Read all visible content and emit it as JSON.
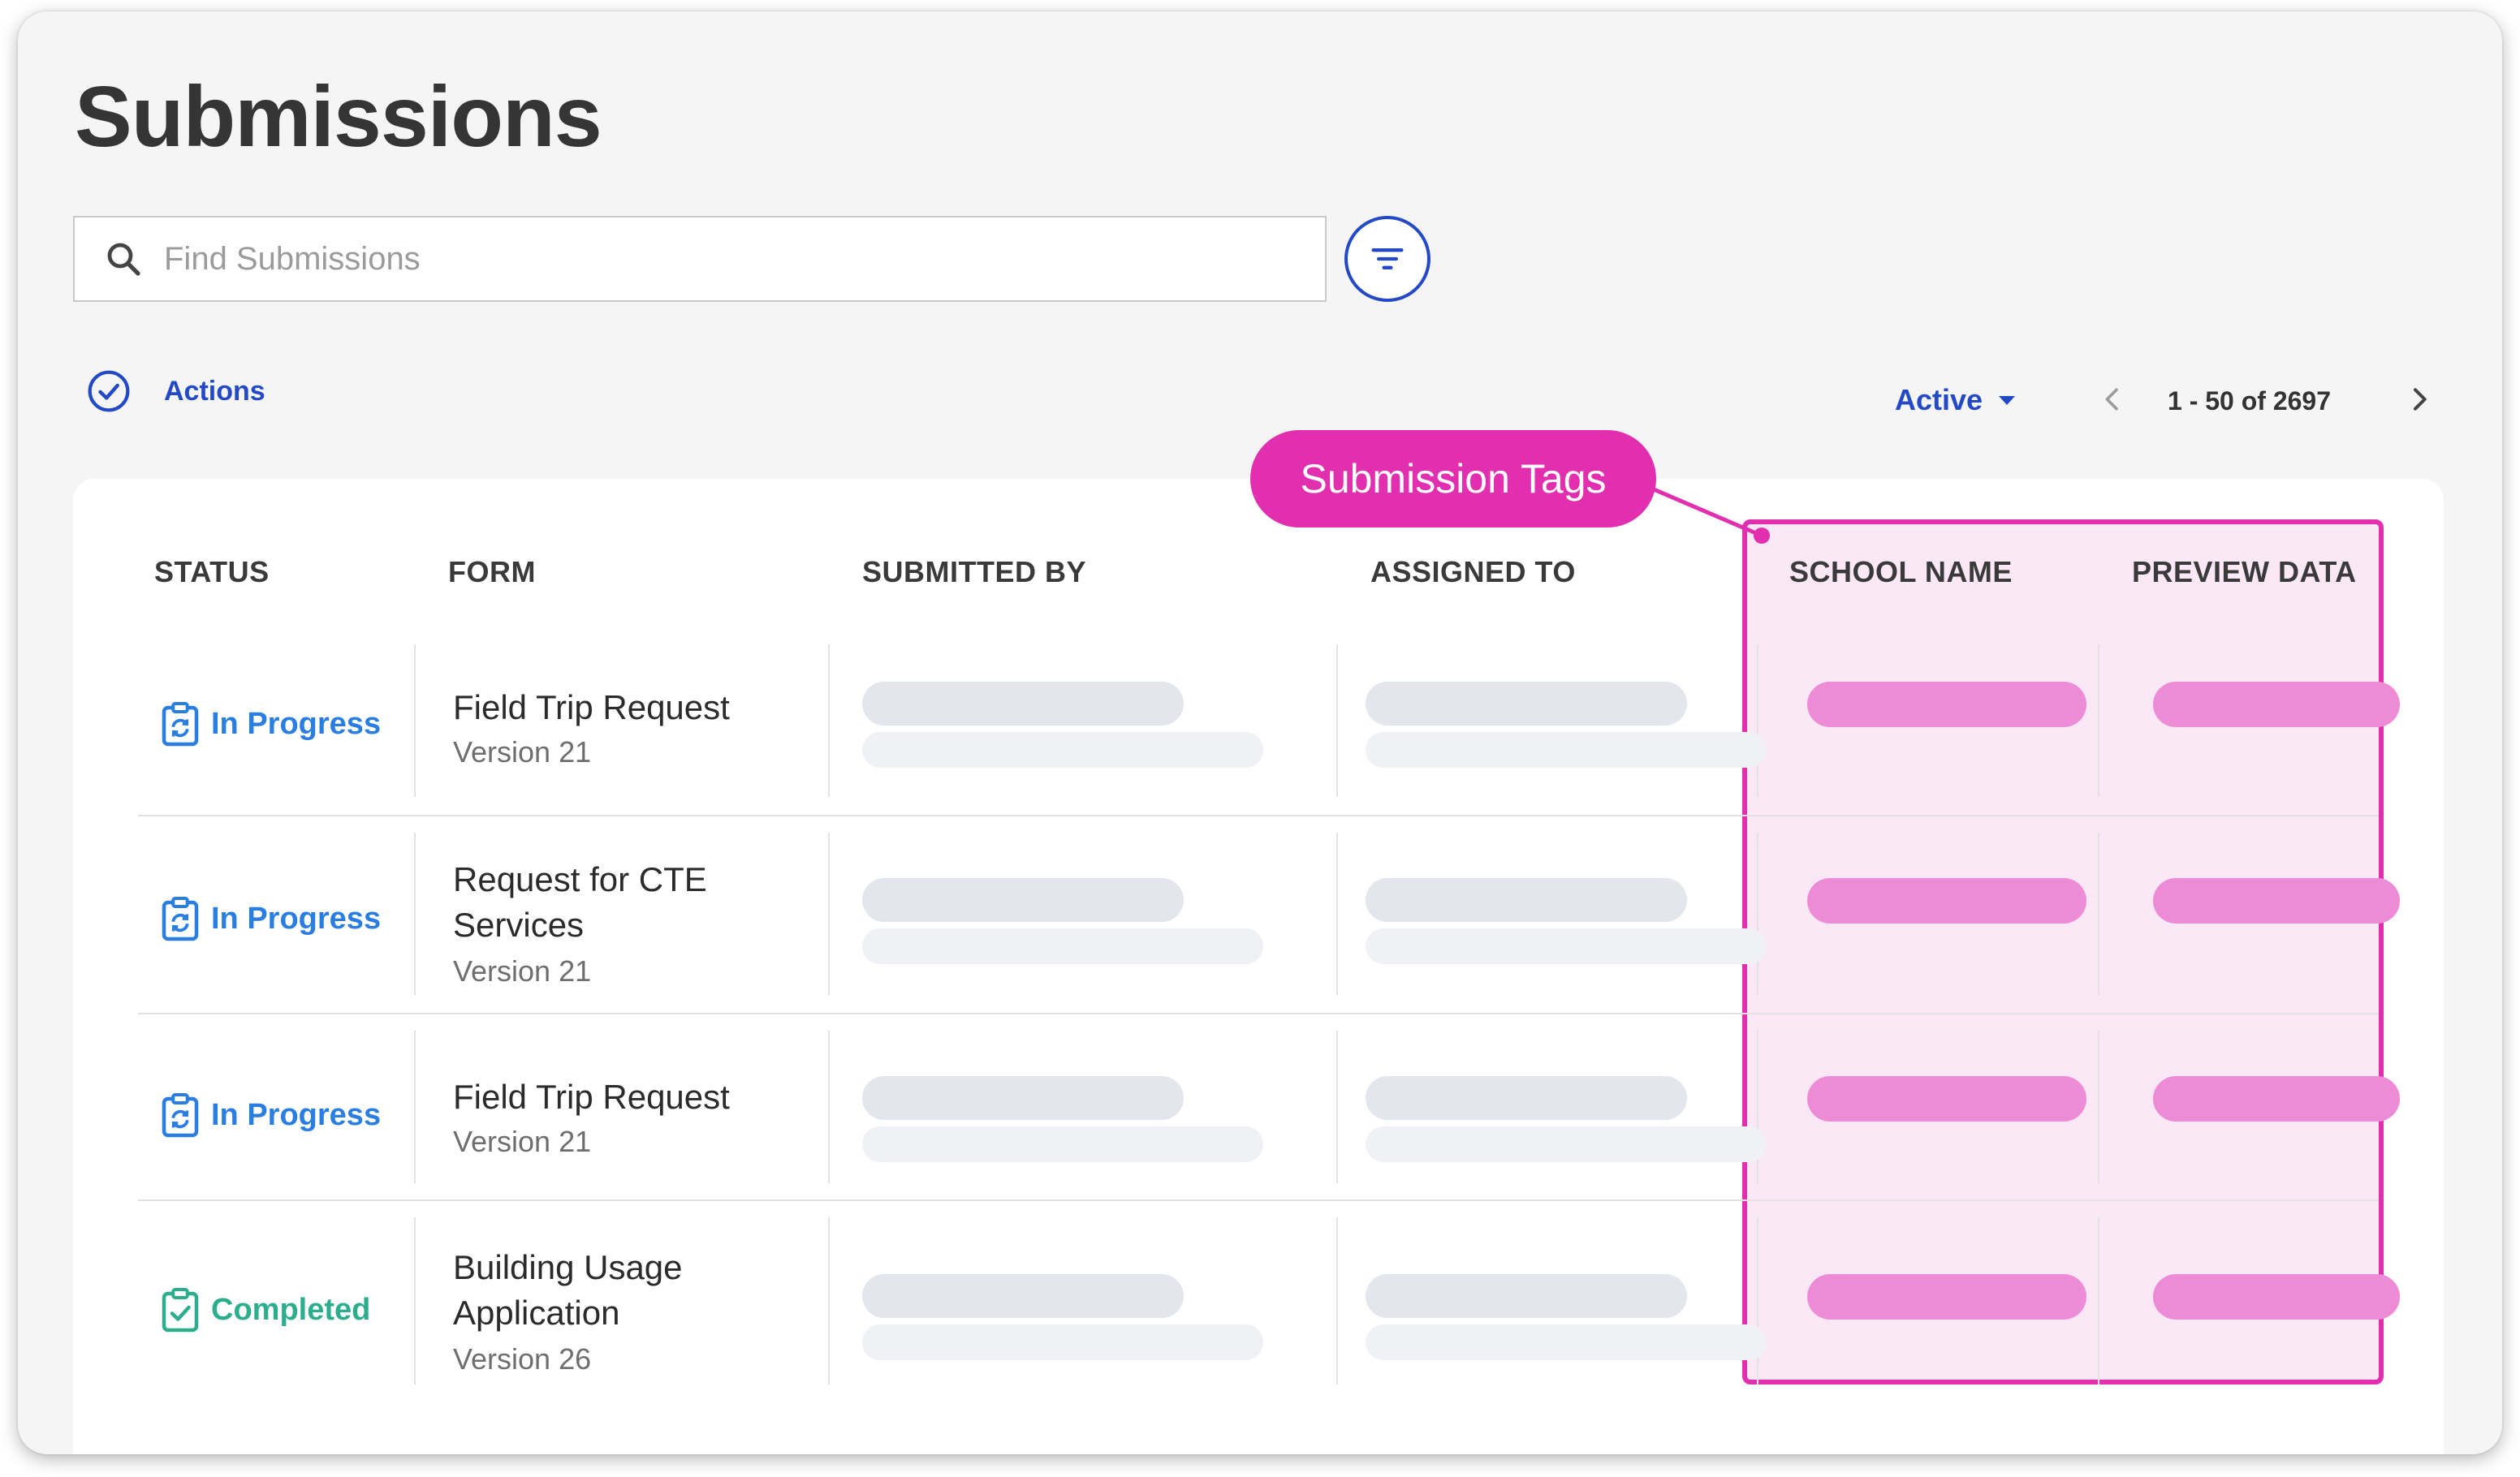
{
  "page": {
    "title": "Submissions"
  },
  "search": {
    "placeholder": "Find Submissions"
  },
  "toolbar": {
    "actions_label": "Actions"
  },
  "filter_dropdown": {
    "selected": "Active"
  },
  "pagination": {
    "range": "1 - 50 of 2697"
  },
  "callout": {
    "label": "Submission Tags"
  },
  "table": {
    "columns": [
      "STATUS",
      "FORM",
      "SUBMITTED BY",
      "ASSIGNED TO",
      "SCHOOL NAME",
      "PREVIEW DATA"
    ],
    "rows": [
      {
        "status": "In Progress",
        "status_type": "in-progress",
        "form": "Field Trip Request",
        "version": "Version 21"
      },
      {
        "status": "In Progress",
        "status_type": "in-progress",
        "form": "Request for CTE Services",
        "version": "Version 21"
      },
      {
        "status": "In Progress",
        "status_type": "in-progress",
        "form": "Field Trip Request",
        "version": "Version 21"
      },
      {
        "status": "Completed",
        "status_type": "completed",
        "form": "Building Usage Application",
        "version": "Version 26"
      }
    ]
  },
  "colors": {
    "accent": "#2449c6",
    "in_progress": "#2a7de1",
    "completed": "#2cae8e",
    "tag_highlight": "#e22fb0",
    "tag_bar": "#ee8bd6",
    "placeholder_bar": "#e3e6ec"
  },
  "icons": {
    "search": "search-icon",
    "filter": "filter-icon",
    "actions": "check-circle-icon",
    "dropdown": "caret-down-icon",
    "prev": "chevron-left-icon",
    "next": "chevron-right-icon",
    "in_progress": "clipboard-sync-icon",
    "completed": "clipboard-check-icon"
  }
}
